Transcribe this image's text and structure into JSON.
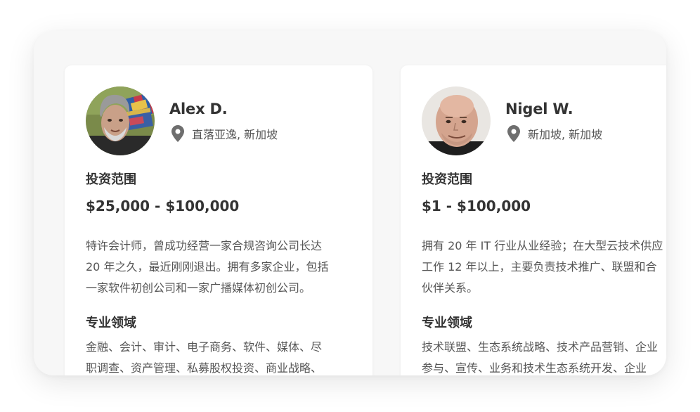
{
  "cards": [
    {
      "name": "Alex D.",
      "location": "直落亚逸, 新加坡",
      "range_label": "投资范围",
      "range": "$25,000 - $100,000",
      "description_lines": [
        "特许会计师，曾成功经营一家合规咨询公司长达",
        "20 年之久，最近刚刚退出。拥有多家企业，包括",
        "一家软件初创公司和一家广播媒体初创公司。"
      ],
      "expertise_label": "专业领域",
      "expertise_lines": [
        "金融、会计、审计、电子商务、软件、媒体、尽",
        "职调查、资产管理、私募股权投资、商业战略、"
      ]
    },
    {
      "name": "Nigel W.",
      "location": "新加坡, 新加坡",
      "range_label": "投资范围",
      "range": "$1 - $100,000",
      "description_lines": [
        "拥有 20 年 IT 行业从业经验；在大型云技术供应",
        "工作 12 年以上，主要负责技术推广、联盟和合",
        "伙伴关系。"
      ],
      "expertise_label": "专业领域",
      "expertise_lines": [
        "技术联盟、生态系统战略、技术产品营销、企业",
        "参与、宣传、业务和技术生态系统开发、企业"
      ]
    }
  ],
  "icons": {
    "location": "location-pin-icon"
  },
  "colors": {
    "text_dark": "#333333",
    "text_body": "#555555",
    "icon_gray": "#6e6e6e",
    "card_bg": "#ffffff",
    "frame_bg": "#f7f7f7"
  }
}
